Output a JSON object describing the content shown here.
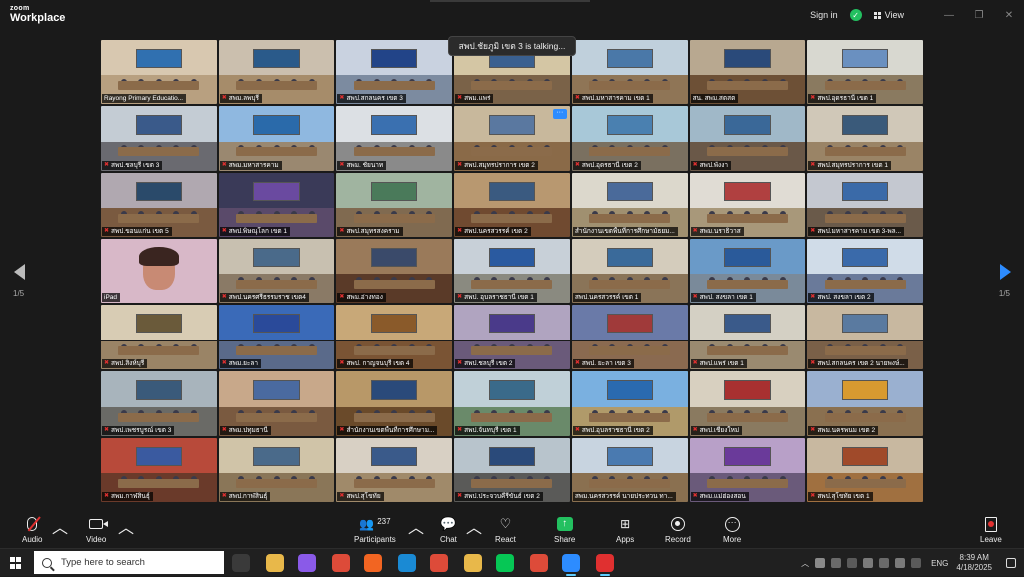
{
  "app": {
    "logo_top": "zoom",
    "logo_bottom": "Workplace",
    "sign_in": "Sign in",
    "view": "View",
    "window_controls": [
      "minimize-icon",
      "maximize-icon",
      "close-icon"
    ]
  },
  "speaking_banner": "สพป.ชัยภูมิ เขต 3 is talking...",
  "gallery": {
    "page_left": "1/5",
    "page_right": "1/5",
    "tiles": [
      {
        "label": "Rayong Primary Educatio...",
        "muted": false,
        "wall": "#d8c8b0",
        "floor": "#b8a080",
        "screen": "#3070b0",
        "kind": "room"
      },
      {
        "label": "สพม.ลพบุรี",
        "muted": true,
        "wall": "#cbbfae",
        "floor": "#a68c6a",
        "screen": "#2a5a8a",
        "kind": "room"
      },
      {
        "label": "สพป.สกลนคร เขต 3",
        "muted": true,
        "wall": "#c9d2e0",
        "floor": "#7c8ba0",
        "screen": "#224488",
        "kind": "room"
      },
      {
        "label": "สพม.แพร่",
        "muted": true,
        "wall": "#d4c6a4",
        "floor": "#7a6248",
        "screen": "#3a6090",
        "kind": "room"
      },
      {
        "label": "สพป.มหาสารคาม เขต 1",
        "muted": true,
        "wall": "#c0d0dc",
        "floor": "#8f7556",
        "screen": "#4a78a8",
        "kind": "room"
      },
      {
        "label": "สน. สพม.สตสต",
        "muted": false,
        "wall": "#b8a890",
        "floor": "#6d5036",
        "screen": "#2a4a7a",
        "kind": "room"
      },
      {
        "label": "สพป.อุดรธานี เขต 1",
        "muted": true,
        "wall": "#d8d8d0",
        "floor": "#8a7a60",
        "screen": "#6a90c0",
        "kind": "room"
      },
      {
        "label": "สพป.ชลบุรี เขต 3",
        "muted": true,
        "wall": "#c4ccd4",
        "floor": "#6a6a70",
        "screen": "#3a5a8a",
        "kind": "room"
      },
      {
        "label": "สพม.มหาสารคาม",
        "muted": true,
        "wall": "#8fb8e0",
        "floor": "#9a8870",
        "screen": "#2a6aaa",
        "kind": "room"
      },
      {
        "label": "สพม. ชัยนาท",
        "muted": true,
        "wall": "#dce0e4",
        "floor": "#8a8a8a",
        "screen": "#3a70b0",
        "kind": "room"
      },
      {
        "label": "สพป.สมุทรปราการ เขต 2",
        "muted": true,
        "wall": "#c8b89c",
        "floor": "#8a6a48",
        "screen": "#5a78a0",
        "kind": "room",
        "more": true
      },
      {
        "label": "สพป.อุดรธานี เขต 2",
        "muted": true,
        "wall": "#a8c8d8",
        "floor": "#7a7060",
        "screen": "#4a80b0",
        "kind": "room"
      },
      {
        "label": "สพป.พังงา",
        "muted": true,
        "wall": "#a0b8c8",
        "floor": "#6a5848",
        "screen": "#3a6898",
        "kind": "room"
      },
      {
        "label": "สพป.สมุทรปราการ เขต 1",
        "muted": true,
        "wall": "#d0c8b8",
        "floor": "#9a8466",
        "screen": "#3a5a7a",
        "kind": "room"
      },
      {
        "label": "สพป.ขอนแก่น เขต 5",
        "muted": true,
        "wall": "#b0a8b0",
        "floor": "#7a5a40",
        "screen": "#2a4a6a",
        "kind": "room"
      },
      {
        "label": "สพป.พิษณุโลก เขต 1",
        "muted": true,
        "wall": "#3a3a58",
        "floor": "#5a4a6a",
        "screen": "#6a4aa0",
        "kind": "room"
      },
      {
        "label": "สพป.สมุทรสงคราม",
        "muted": true,
        "wall": "#a0b4a0",
        "floor": "#806a50",
        "screen": "#4a7a5a",
        "kind": "room"
      },
      {
        "label": "สพป.นครสวรรค์ เขต 2",
        "muted": true,
        "wall": "#b89870",
        "floor": "#704a30",
        "screen": "#3a5a80",
        "kind": "room"
      },
      {
        "label": "สำนักงานเขตพื้นที่การศึกษามัธยม...",
        "muted": false,
        "wall": "#dcd8cc",
        "floor": "#a09070",
        "screen": "#4a6a9a",
        "kind": "room"
      },
      {
        "label": "สพม.นราธิวาส",
        "muted": true,
        "wall": "#e0dcd4",
        "floor": "#a8987a",
        "screen": "#b04040",
        "kind": "room"
      },
      {
        "label": "สพป.มหาสารคาม เขต 3-พล...",
        "muted": true,
        "wall": "#c4c8d0",
        "floor": "#6a5a4a",
        "screen": "#3a6aa8",
        "kind": "room"
      },
      {
        "label": "iPad",
        "muted": false,
        "wall": "#d8b8c8",
        "floor": "#b898a8",
        "screen": "#d8b8c8",
        "kind": "face"
      },
      {
        "label": "สพป.นครศรีธรรมราช เขต4",
        "muted": true,
        "wall": "#c8c0b0",
        "floor": "#8a7a66",
        "screen": "#4a6a8a",
        "kind": "room"
      },
      {
        "label": "สพม.อ่างทอง",
        "muted": true,
        "wall": "#9a7a5a",
        "floor": "#5a3a28",
        "screen": "#3a4a6a",
        "kind": "room"
      },
      {
        "label": "สพป. อุบลราชธานี เขต 1",
        "muted": true,
        "wall": "#c8d0d8",
        "floor": "#8a8a80",
        "screen": "#2a5aa0",
        "kind": "room"
      },
      {
        "label": "สพป.นครสวรรค์ เขต 1",
        "muted": false,
        "wall": "#d4ccbc",
        "floor": "#8a7458",
        "screen": "#3a6a9a",
        "kind": "room"
      },
      {
        "label": "สพป. สงขลา เขต 1",
        "muted": true,
        "wall": "#6a9ac8",
        "floor": "#7a8a9a",
        "screen": "#2a5a9a",
        "kind": "room"
      },
      {
        "label": "สพป. สงขลา เขต 2",
        "muted": true,
        "wall": "#d0dce8",
        "floor": "#6a7a9a",
        "screen": "#3a6aaa",
        "kind": "room"
      },
      {
        "label": "สพป.สิงห์บุรี",
        "muted": true,
        "wall": "#d8ccb4",
        "floor": "#9a8466",
        "screen": "#6a5a3a",
        "kind": "room"
      },
      {
        "label": "สพม.ยะลา",
        "muted": true,
        "wall": "#3a6ab8",
        "floor": "#5a6a8a",
        "screen": "#2a4a9a",
        "kind": "room"
      },
      {
        "label": "สพป. กาญจนบุรี เขต 4",
        "muted": true,
        "wall": "#c8a878",
        "floor": "#7a5434",
        "screen": "#8a5a2a",
        "kind": "room"
      },
      {
        "label": "สพป.ชลบุรี เขต 2",
        "muted": true,
        "wall": "#b0a4c0",
        "floor": "#6a5a7a",
        "screen": "#4a3a8a",
        "kind": "room"
      },
      {
        "label": "สพป. ยะลา เขต 3",
        "muted": true,
        "wall": "#6a7aa8",
        "floor": "#8a6a50",
        "screen": "#a03a3a",
        "kind": "room"
      },
      {
        "label": "สพป.แพร่ เขต 1",
        "muted": true,
        "wall": "#d4d0c4",
        "floor": "#9a8a70",
        "screen": "#3a5a8a",
        "kind": "room"
      },
      {
        "label": "สพป.สกลนคร เขต 2 นายพงษ์...",
        "muted": true,
        "wall": "#c8b8a0",
        "floor": "#7a6048",
        "screen": "#5a7aa0",
        "kind": "room"
      },
      {
        "label": "สพป.เพชรบูรณ์ เขต 3",
        "muted": true,
        "wall": "#a8b4bc",
        "floor": "#6a6a66",
        "screen": "#3a5a7a",
        "kind": "room"
      },
      {
        "label": "สพม.ปทุมธานี",
        "muted": true,
        "wall": "#c8a88a",
        "floor": "#7a5a40",
        "screen": "#4a6aa0",
        "kind": "room"
      },
      {
        "label": "สำนักงานเขตพื้นที่การศึกษาม...",
        "muted": true,
        "wall": "#b89868",
        "floor": "#6a4a2a",
        "screen": "#2a4a7a",
        "kind": "room"
      },
      {
        "label": "สพป.จันทบุรี เขต 1",
        "muted": true,
        "wall": "#c0d0d8",
        "floor": "#6a8a6a",
        "screen": "#3a6a8a",
        "kind": "room"
      },
      {
        "label": "สพป.อุบลราชธานี เขต 2",
        "muted": true,
        "wall": "#7ab0e0",
        "floor": "#b09a6a",
        "screen": "#2a6ab0",
        "kind": "room",
        "highlight": true
      },
      {
        "label": "สพป.เชียงใหม่",
        "muted": true,
        "wall": "#d8d0c0",
        "floor": "#8a7a60",
        "screen": "#a83030",
        "kind": "room"
      },
      {
        "label": "สพม.นครพนม เขต 2",
        "muted": true,
        "wall": "#9ab0d0",
        "floor": "#8a7050",
        "screen": "#d89a30",
        "kind": "room"
      },
      {
        "label": "สพม.กาฬสินธุ์",
        "muted": true,
        "wall": "#b84a3a",
        "floor": "#6a3a2a",
        "screen": "#3a5aa0",
        "kind": "room"
      },
      {
        "label": "สพป.กาฬสินธุ์",
        "muted": true,
        "wall": "#d0c4a8",
        "floor": "#8a7658",
        "screen": "#4a6a8a",
        "kind": "room"
      },
      {
        "label": "สพป.สุโขทัย",
        "muted": true,
        "wall": "#d8d0c4",
        "floor": "#a08a6a",
        "screen": "#3a5a8a",
        "kind": "room"
      },
      {
        "label": "สพป.ประจวบคีรีขันธ์ เขต 2",
        "muted": true,
        "wall": "#b8c4cc",
        "floor": "#5a5a58",
        "screen": "#2a4a7a",
        "kind": "room"
      },
      {
        "label": "สพม.นครสวรรค์ นายประทวน ทา...",
        "muted": false,
        "wall": "#c8d4e0",
        "floor": "#8a7050",
        "screen": "#4a7ab0",
        "kind": "room"
      },
      {
        "label": "สพม.แม่ฮ่องสอน",
        "muted": true,
        "wall": "#b8a0c8",
        "floor": "#6a5a7a",
        "screen": "#6a3a9a",
        "kind": "room"
      },
      {
        "label": "สพป.สุโขทัย เขต 1",
        "muted": true,
        "wall": "#c8b8a0",
        "floor": "#a07040",
        "screen": "#a04a2a",
        "kind": "room"
      }
    ]
  },
  "toolbar": {
    "audio": "Audio",
    "video": "Video",
    "participants": "Participants",
    "participants_count": "237",
    "chat": "Chat",
    "react": "React",
    "share": "Share",
    "apps": "Apps",
    "record": "Record",
    "more": "More",
    "leave": "Leave"
  },
  "taskbar": {
    "search_placeholder": "Type here to search",
    "language": "ENG",
    "time": "8:39 AM",
    "date": "4/18/2025",
    "apps": [
      {
        "name": "task-view-icon",
        "color": "#3a3a3a"
      },
      {
        "name": "file-explorer-icon",
        "color": "#e8b84a"
      },
      {
        "name": "copilot-icon",
        "color": "#8a5ae8"
      },
      {
        "name": "chrome-icon",
        "color": "#dd4b39"
      },
      {
        "name": "rss-app-icon",
        "color": "#f26522"
      },
      {
        "name": "edge-icon",
        "color": "#1a8ad4"
      },
      {
        "name": "chrome-profile-icon",
        "color": "#dd4b39"
      },
      {
        "name": "folder-icon",
        "color": "#e8b84a"
      },
      {
        "name": "line-icon",
        "color": "#06c755"
      },
      {
        "name": "chrome-alt-icon",
        "color": "#dd4b39"
      },
      {
        "name": "zoom-icon",
        "color": "#2d8cff"
      },
      {
        "name": "audio-recorder-icon",
        "color": "#e03030"
      }
    ]
  }
}
